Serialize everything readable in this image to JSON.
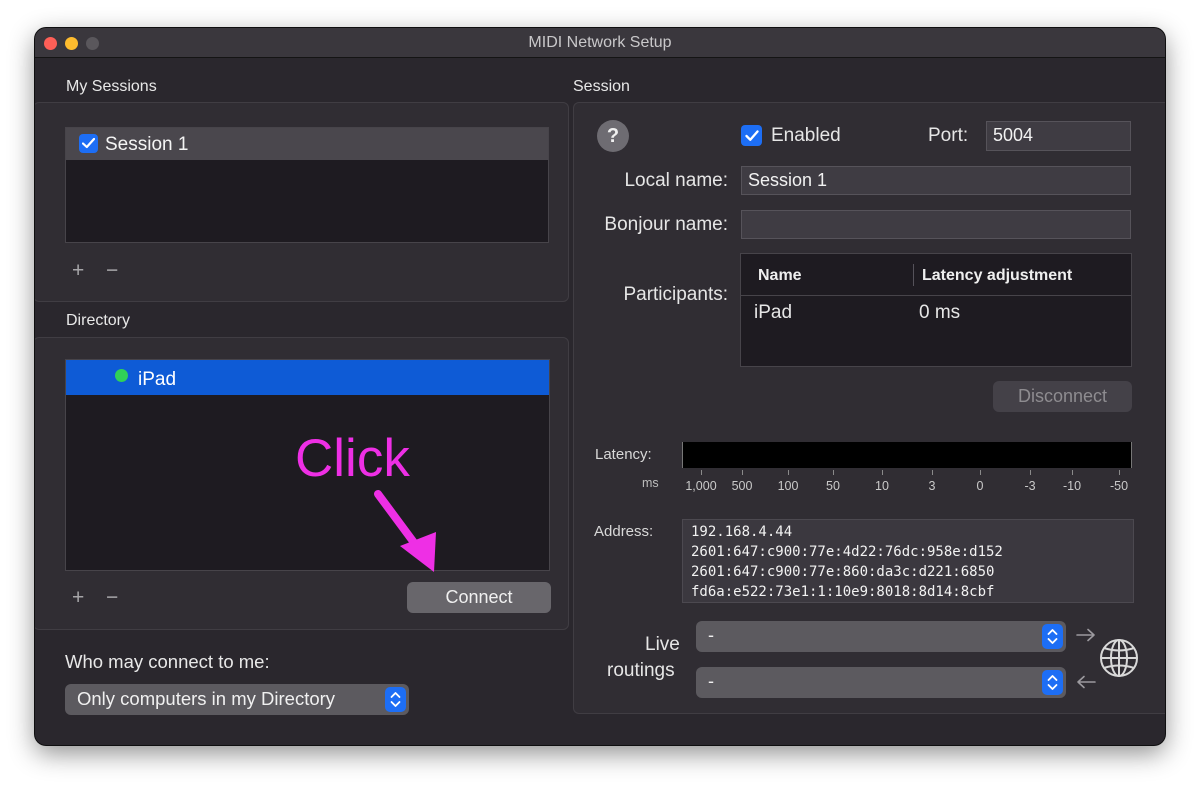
{
  "window": {
    "title": "MIDI Network Setup"
  },
  "my_sessions": {
    "heading": "My Sessions",
    "items": [
      {
        "label": "Session 1",
        "checked": true
      }
    ],
    "add_label": "+",
    "remove_label": "−"
  },
  "directory": {
    "heading": "Directory",
    "items": [
      {
        "label": "iPad",
        "status": "online",
        "status_color": "#30d158"
      }
    ],
    "add_label": "+",
    "remove_label": "−",
    "connect_label": "Connect"
  },
  "access": {
    "label": "Who may connect to me:",
    "selected": "Only computers in my Directory"
  },
  "session": {
    "heading": "Session",
    "help_label": "?",
    "enabled_label": "Enabled",
    "enabled": true,
    "port_label": "Port:",
    "port_value": "5004",
    "local_name_label": "Local name:",
    "local_name_value": "Session 1",
    "bonjour_name_label": "Bonjour name:",
    "bonjour_name_value": "",
    "participants_label": "Participants:",
    "participants_columns": [
      "Name",
      "Latency adjustment"
    ],
    "participants_rows": [
      {
        "name": "iPad",
        "latency": "0 ms"
      }
    ],
    "disconnect_label": "Disconnect",
    "latency_label": "Latency:",
    "latency_unit": "ms",
    "latency_scale": [
      "1,000",
      "500",
      "100",
      "50",
      "10",
      "3",
      "0",
      "-3",
      "-10",
      "-50"
    ],
    "address_label": "Address:",
    "addresses": [
      "192.168.4.44",
      "2601:647:c900:77e:4d22:76dc:958e:d152",
      "2601:647:c900:77e:860:da3c:d221:6850",
      "fd6a:e522:73e1:1:10e9:8018:8d14:8cbf"
    ],
    "live_routings_label_1": "Live",
    "live_routings_label_2": "routings",
    "routing_in_value": "-",
    "routing_out_value": "-"
  },
  "annotation": {
    "text": "Click",
    "color": "#ee2fe5"
  },
  "colors": {
    "window_bg": "#2a272d",
    "accent": "#1d6ef5",
    "selection": "#0e5bd6"
  },
  "icons": [
    "checkmark-icon",
    "status-dot-icon",
    "help-icon",
    "updown-chevron-icon",
    "arrow-right-icon",
    "arrow-left-icon",
    "globe-icon",
    "annotation-arrow-icon"
  ]
}
